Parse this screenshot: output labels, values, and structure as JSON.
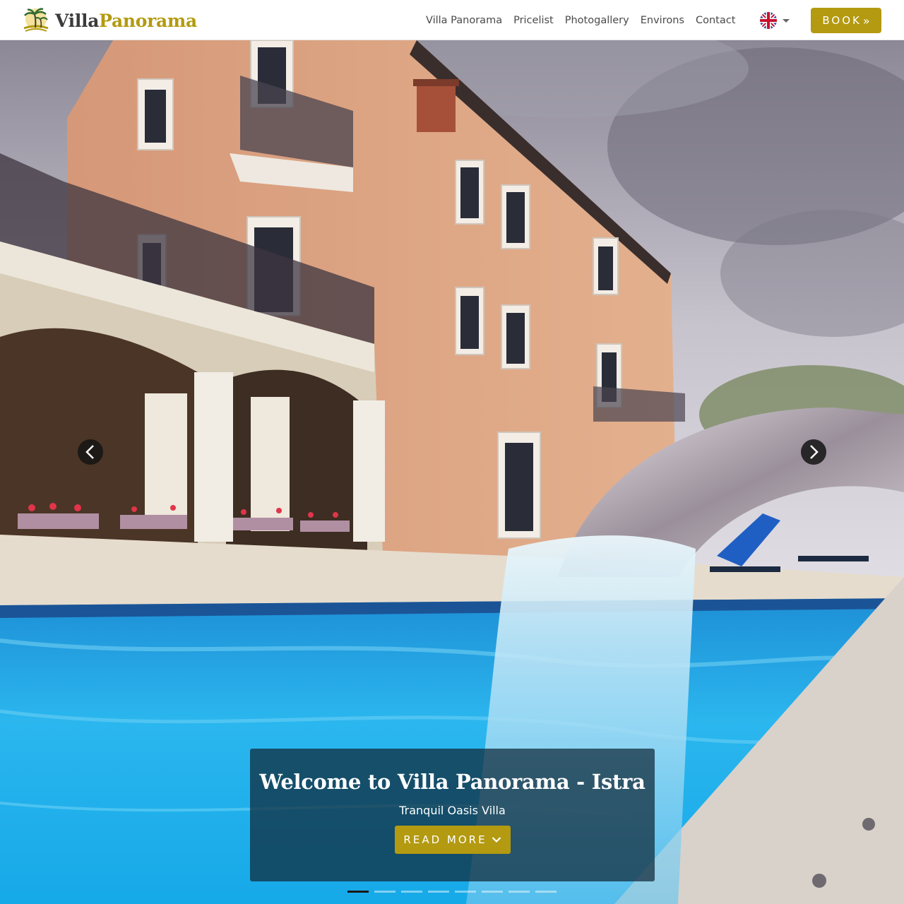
{
  "brand": {
    "name_part1": "Villa",
    "name_part2": "Panorama"
  },
  "nav": {
    "items": [
      "Villa Panorama",
      "Pricelist",
      "Photogallery",
      "Environs",
      "Contact"
    ],
    "language_icon": "uk-flag-icon"
  },
  "book_button": {
    "label": "BOOK",
    "icon": "chevron-double-right-icon"
  },
  "hero": {
    "title": "Welcome to Villa Panorama - Istra",
    "subtitle": "Tranquil Oasis Villa",
    "cta_label": "READ MORE",
    "cta_icon": "chevron-down-icon",
    "slide_count": 8,
    "active_slide": 1
  },
  "colors": {
    "accent": "#b39a10",
    "nav_text": "#4a4a4a",
    "caption_bg": "rgba(15,40,55,0.72)"
  }
}
